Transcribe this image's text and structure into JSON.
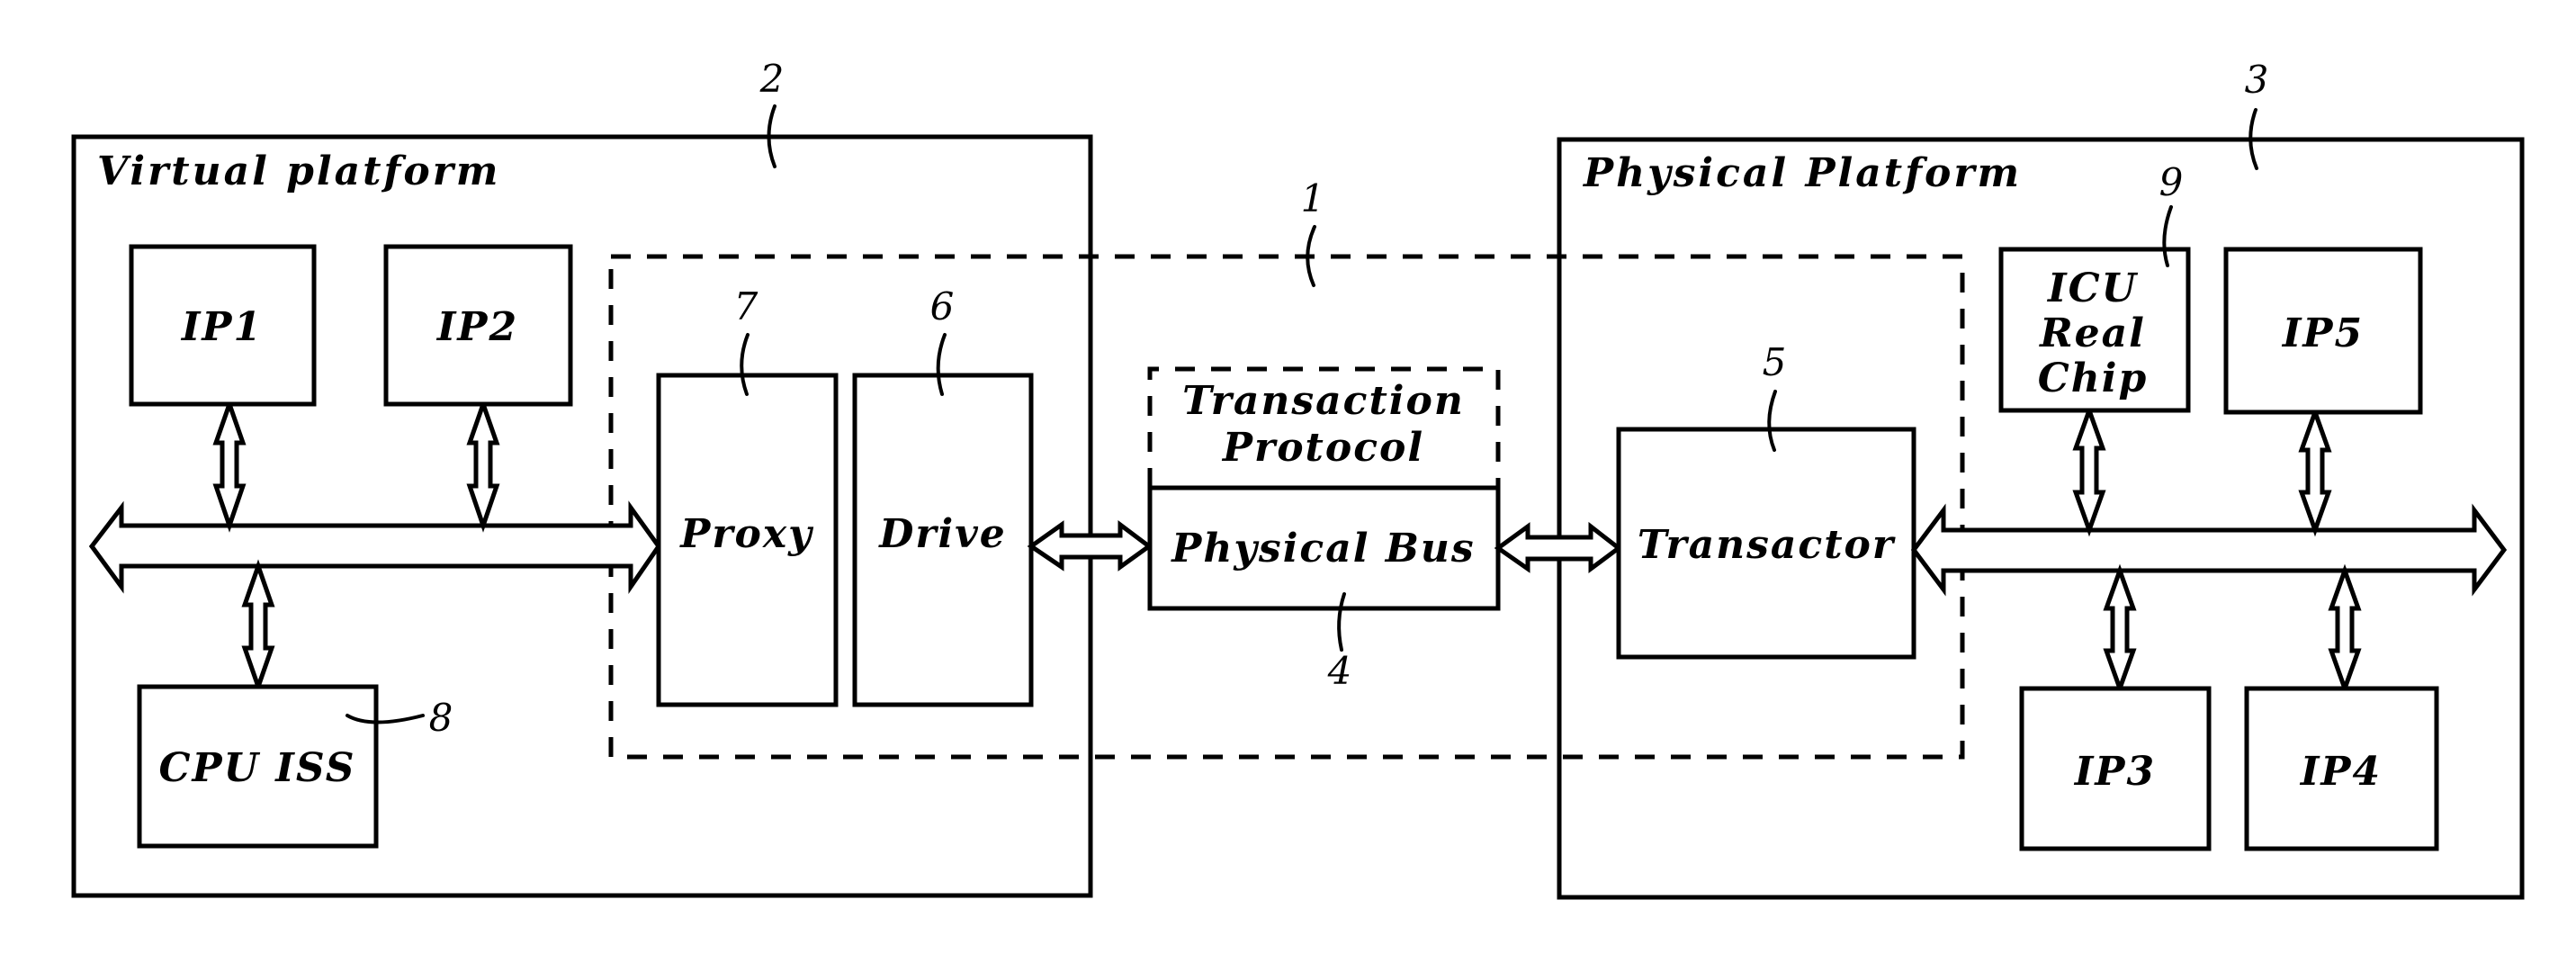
{
  "figure": {
    "stroke_color": "#000000",
    "background": "#ffffff"
  },
  "reference_numerals": {
    "system": "1",
    "virtual_platform": "2",
    "physical_platform": "3",
    "physical_bus": "4",
    "transactor": "5",
    "drive": "6",
    "proxy": "7",
    "cpu_iss": "8",
    "icu": "9"
  },
  "virtual_platform": {
    "title": "Virtual platform",
    "blocks": {
      "ip1": "IP1",
      "ip2": "IP2",
      "cpu_iss": "CPU ISS",
      "proxy": "Proxy",
      "drive": "Drive"
    }
  },
  "middle": {
    "protocol_line1": "Transaction",
    "protocol_line2": "Protocol",
    "physical_bus": "Physical Bus"
  },
  "physical_platform": {
    "title": "Physical Platform",
    "blocks": {
      "icu_line1": "ICU",
      "icu_line2": "Real",
      "icu_line3": "Chip",
      "ip5": "IP5",
      "ip3": "IP3",
      "ip4": "IP4",
      "transactor": "Transactor"
    }
  }
}
